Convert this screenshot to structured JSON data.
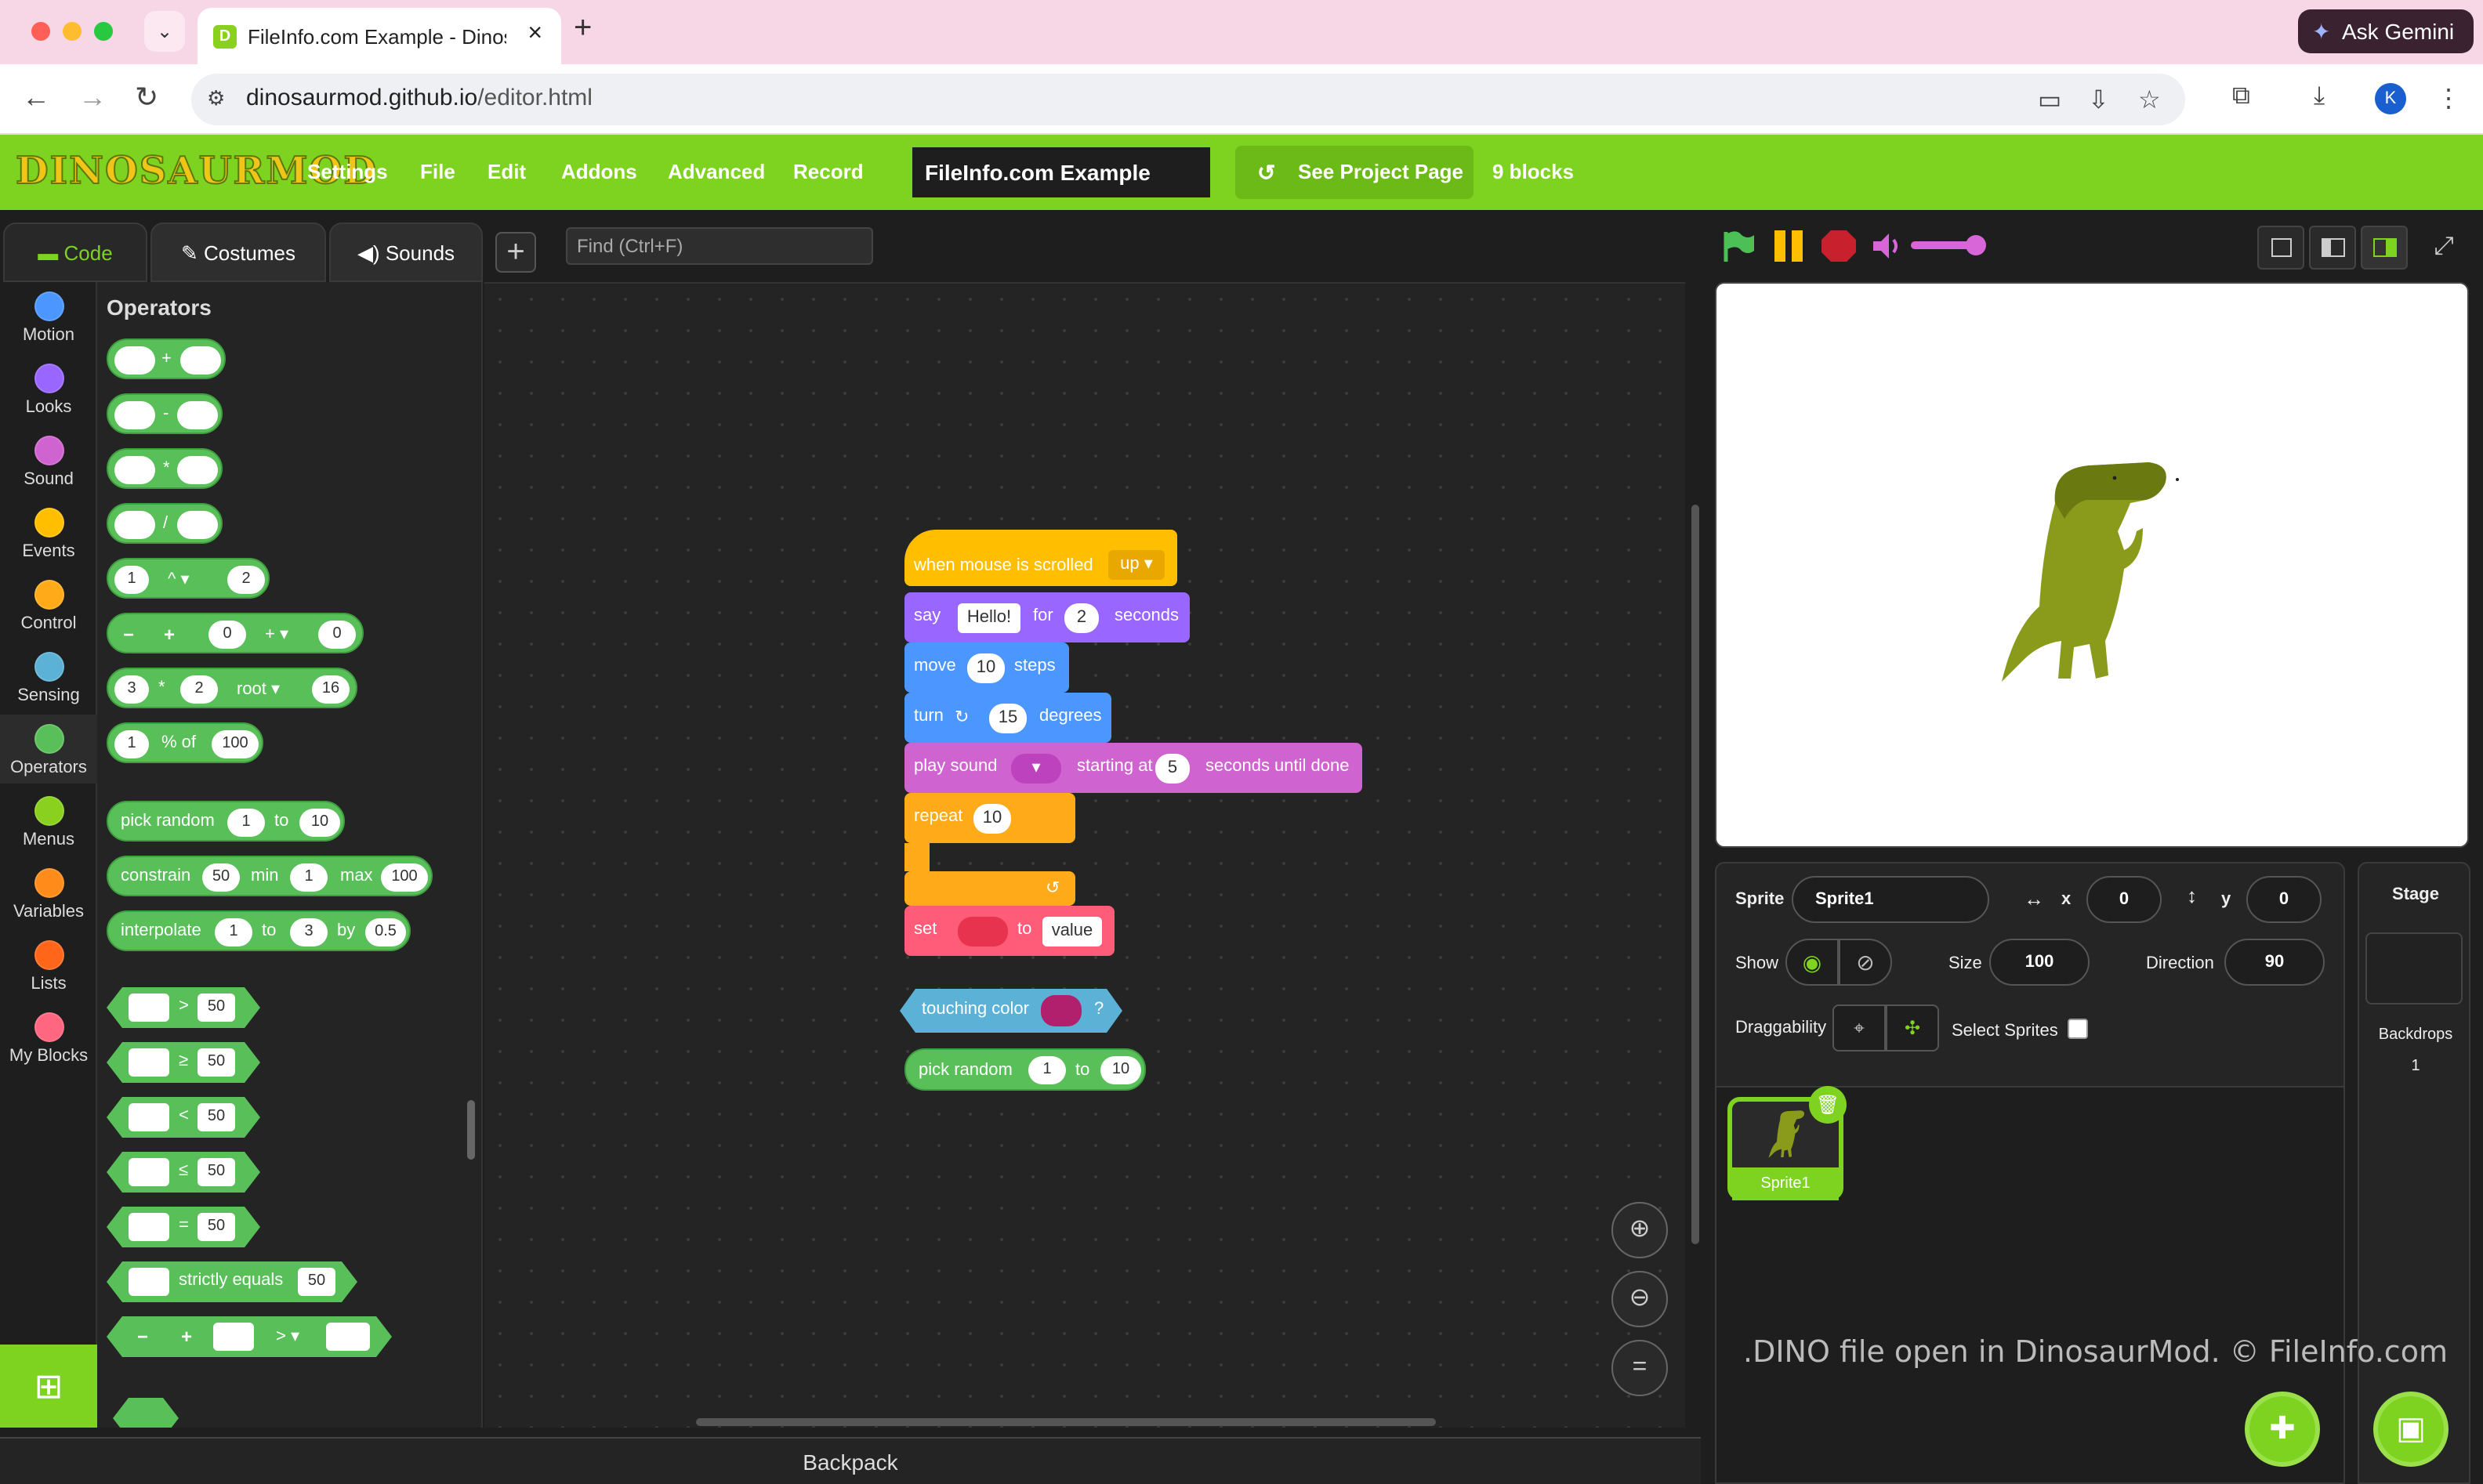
{
  "browser": {
    "tab_title": "FileInfo.com Example - Dinos...",
    "tab_favicon": "D",
    "url_domain": "dinosaurmod.github.io",
    "url_path": "/editor.html",
    "ask_gemini": "Ask Gemini",
    "avatar_initial": "K"
  },
  "menubar": {
    "logo": "DINOSAURMOD",
    "items": [
      "Settings",
      "File",
      "Edit",
      "Addons",
      "Advanced",
      "Record"
    ],
    "project_title": "FileInfo.com Example",
    "see_project": "See Project Page",
    "block_count": "9 blocks"
  },
  "editor_tabs": [
    "Code",
    "Costumes",
    "Sounds"
  ],
  "find_placeholder": "Find (Ctrl+F)",
  "categories": [
    {
      "label": "Motion",
      "color": "#4c97ff"
    },
    {
      "label": "Looks",
      "color": "#9966ff"
    },
    {
      "label": "Sound",
      "color": "#cf63cf"
    },
    {
      "label": "Events",
      "color": "#ffbf00"
    },
    {
      "label": "Control",
      "color": "#ffab19"
    },
    {
      "label": "Sensing",
      "color": "#5cb1d6"
    },
    {
      "label": "Operators",
      "color": "#59c059"
    },
    {
      "label": "Menus",
      "color": "#8ad01e"
    },
    {
      "label": "Variables",
      "color": "#ff8c1a"
    },
    {
      "label": "Lists",
      "color": "#ff661a"
    },
    {
      "label": "My Blocks",
      "color": "#ff6680"
    }
  ],
  "flyout": {
    "heading": "Operators",
    "add": "+",
    "sub": "-",
    "mul": "*",
    "div": "/",
    "pow": {
      "a": "1",
      "op": "^",
      "b": "2"
    },
    "stepper": {
      "a": "0",
      "op": "+",
      "b": "0"
    },
    "root": {
      "a": "3",
      "op": "*",
      "b": "2",
      "fn": "root",
      "c": "16"
    },
    "percent": {
      "a": "1",
      "label": "% of",
      "b": "100"
    },
    "pick_random": {
      "label": "pick random",
      "a": "1",
      "to": "to",
      "b": "10"
    },
    "constrain": {
      "label": "constrain",
      "a": "50",
      "min": "min",
      "b": "1",
      "max": "max",
      "c": "100"
    },
    "interpolate": {
      "label": "interpolate",
      "a": "1",
      "to": "to",
      "b": "3",
      "by": "by",
      "c": "0.5"
    },
    "compare": [
      {
        "op": ">",
        "val": "50"
      },
      {
        "op": "≥",
        "val": "50"
      },
      {
        "op": "<",
        "val": "50"
      },
      {
        "op": "≤",
        "val": "50"
      },
      {
        "op": "=",
        "val": "50"
      }
    ],
    "strict": {
      "label": "strictly equals",
      "val": "50"
    },
    "last_op": ">"
  },
  "script": {
    "hat": {
      "label": "when mouse is scrolled",
      "dir": "up"
    },
    "say": {
      "label": "say",
      "text": "Hello!",
      "for": "for",
      "secs": "2",
      "unit": "seconds"
    },
    "move": {
      "label": "move",
      "n": "10",
      "unit": "steps"
    },
    "turn": {
      "label": "turn",
      "n": "15",
      "unit": "degrees"
    },
    "play": {
      "label": "play sound",
      "start": "starting at",
      "n": "5",
      "until": "seconds until done"
    },
    "repeat": {
      "label": "repeat",
      "n": "10"
    },
    "set": {
      "label": "set",
      "to": "to",
      "value": "value"
    },
    "touching": {
      "label": "touching color",
      "q": "?"
    },
    "random": {
      "label": "pick random",
      "a": "1",
      "to": "to",
      "b": "10"
    }
  },
  "backpack": "Backpack",
  "sprite": {
    "label": "Sprite",
    "name": "Sprite1",
    "x_label": "x",
    "x": "0",
    "y_label": "y",
    "y": "0",
    "show": "Show",
    "size_label": "Size",
    "size": "100",
    "dir_label": "Direction",
    "direction": "90",
    "drag": "Draggability",
    "select": "Select Sprites",
    "thumb_name": "Sprite1"
  },
  "stage_pane": {
    "label": "Stage",
    "backdrops": "Backdrops",
    "count": "1"
  },
  "watermark": ".DINO file open in DinosaurMod. © FileInfo.com"
}
